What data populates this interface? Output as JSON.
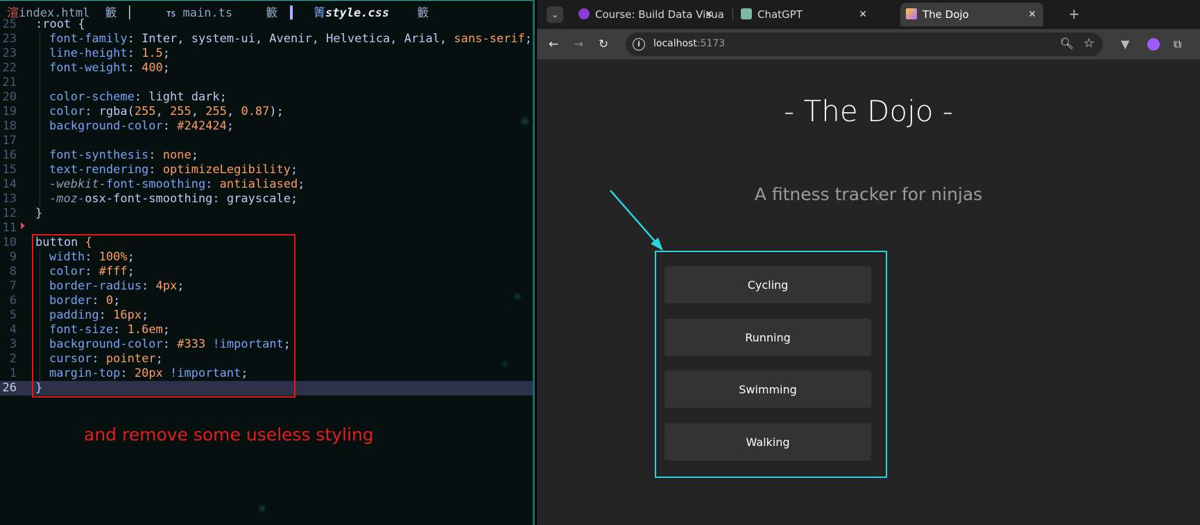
{
  "editor": {
    "tabs": [
      {
        "icon": "渲",
        "name": "index.html",
        "status": "籔"
      },
      {
        "icon": "TS",
        "name": "main.ts",
        "status": "籔"
      },
      {
        "icon": "箐",
        "name": "style.css",
        "status": "籔"
      }
    ],
    "lines": [
      {
        "num": "25",
        "parts": [
          [
            ":root {",
            "w"
          ]
        ]
      },
      {
        "num": "23",
        "in": true,
        "parts": [
          [
            "font-family",
            "p"
          ],
          [
            ": Inter, system-ui, Avenir, Helvetica, Arial, ",
            "w"
          ],
          [
            "sans-serif",
            "v"
          ],
          [
            ";",
            "w"
          ]
        ]
      },
      {
        "num": "23",
        "in": true,
        "parts": [
          [
            "line-height",
            "p"
          ],
          [
            ": ",
            "w"
          ],
          [
            "1.5",
            "v"
          ],
          [
            ";",
            "w"
          ]
        ]
      },
      {
        "num": "22",
        "in": true,
        "parts": [
          [
            "font-weight",
            "p"
          ],
          [
            ": ",
            "w"
          ],
          [
            "400",
            "v"
          ],
          [
            ";",
            "w"
          ]
        ]
      },
      {
        "num": "21",
        "in": true,
        "parts": []
      },
      {
        "num": "20",
        "in": true,
        "parts": [
          [
            "color-scheme",
            "p"
          ],
          [
            ": light dark;",
            "w"
          ]
        ]
      },
      {
        "num": "19",
        "in": true,
        "parts": [
          [
            "color",
            "p"
          ],
          [
            ": rgba(",
            "w"
          ],
          [
            "255",
            "v"
          ],
          [
            ", ",
            "w"
          ],
          [
            "255",
            "v"
          ],
          [
            ", ",
            "w"
          ],
          [
            "255",
            "v"
          ],
          [
            ", ",
            "w"
          ],
          [
            "0.87",
            "v"
          ],
          [
            ");",
            "w"
          ]
        ]
      },
      {
        "num": "18",
        "in": true,
        "parts": [
          [
            "background-color",
            "p"
          ],
          [
            ": ",
            "w"
          ],
          [
            "#242424",
            "v"
          ],
          [
            ";",
            "w"
          ]
        ]
      },
      {
        "num": "17",
        "in": true,
        "parts": []
      },
      {
        "num": "16",
        "in": true,
        "parts": [
          [
            "font-synthesis",
            "p"
          ],
          [
            ": ",
            "w"
          ],
          [
            "none",
            "v"
          ],
          [
            ";",
            "w"
          ]
        ]
      },
      {
        "num": "15",
        "in": true,
        "parts": [
          [
            "text-rendering",
            "p"
          ],
          [
            ": ",
            "w"
          ],
          [
            "optimizeLegibility",
            "v"
          ],
          [
            ";",
            "w"
          ]
        ]
      },
      {
        "num": "14",
        "in": true,
        "parts": [
          [
            "-webkit-",
            "it"
          ],
          [
            "font-smoothing",
            "p"
          ],
          [
            ": ",
            "w"
          ],
          [
            "antialiased",
            "v"
          ],
          [
            ";",
            "w"
          ]
        ]
      },
      {
        "num": "13",
        "in": true,
        "parts": [
          [
            "-moz-",
            "it"
          ],
          [
            "osx-font-smoothing",
            "w"
          ],
          [
            ": grayscale;",
            "w"
          ]
        ]
      },
      {
        "num": "12",
        "parts": [
          [
            "}",
            "w"
          ]
        ]
      },
      {
        "num": "11",
        "parts": []
      },
      {
        "num": "10",
        "parts": [
          [
            "button ",
            "w"
          ],
          [
            "{",
            "v"
          ]
        ]
      },
      {
        "num": "9",
        "in": true,
        "parts": [
          [
            "width",
            "p"
          ],
          [
            ": ",
            "w"
          ],
          [
            "100%",
            "v"
          ],
          [
            ";",
            "w"
          ]
        ]
      },
      {
        "num": "8",
        "in": true,
        "parts": [
          [
            "color",
            "p"
          ],
          [
            ": ",
            "w"
          ],
          [
            "#fff",
            "v"
          ],
          [
            ";",
            "w"
          ]
        ]
      },
      {
        "num": "7",
        "in": true,
        "parts": [
          [
            "border-radius",
            "p"
          ],
          [
            ": ",
            "w"
          ],
          [
            "4px",
            "v"
          ],
          [
            ";",
            "w"
          ]
        ]
      },
      {
        "num": "6",
        "in": true,
        "parts": [
          [
            "border",
            "p"
          ],
          [
            ": ",
            "w"
          ],
          [
            "0",
            "v"
          ],
          [
            ";",
            "w"
          ]
        ]
      },
      {
        "num": "5",
        "in": true,
        "parts": [
          [
            "padding",
            "p"
          ],
          [
            ": ",
            "w"
          ],
          [
            "16px",
            "v"
          ],
          [
            ";",
            "w"
          ]
        ]
      },
      {
        "num": "4",
        "in": true,
        "parts": [
          [
            "font-size",
            "p"
          ],
          [
            ": ",
            "w"
          ],
          [
            "1.6em",
            "v"
          ],
          [
            ";",
            "w"
          ]
        ]
      },
      {
        "num": "3",
        "in": true,
        "parts": [
          [
            "background-color",
            "p"
          ],
          [
            ": ",
            "w"
          ],
          [
            "#333",
            "v"
          ],
          [
            " !important",
            "p"
          ],
          [
            ";",
            "w"
          ]
        ]
      },
      {
        "num": "2",
        "in": true,
        "parts": [
          [
            "cursor",
            "p"
          ],
          [
            ": ",
            "w"
          ],
          [
            "pointer",
            "v"
          ],
          [
            ";",
            "w"
          ]
        ]
      },
      {
        "num": "1",
        "in": true,
        "parts": [
          [
            "margin-top",
            "p"
          ],
          [
            ": ",
            "w"
          ],
          [
            "20px",
            "v"
          ],
          [
            " !important",
            "p"
          ],
          [
            ";",
            "w"
          ]
        ]
      },
      {
        "num": "26",
        "cur": true,
        "parts": [
          [
            "}",
            "w"
          ]
        ]
      }
    ],
    "note": "and remove some useless styling"
  },
  "browser": {
    "tabs": [
      {
        "label": "Course: Build Data Visua",
        "icon_color": "#8b3ad6",
        "icon": "course-favicon-icon"
      },
      {
        "label": "ChatGPT",
        "icon_color": "#7fb8a8",
        "icon": "chatgpt-favicon-icon"
      },
      {
        "label": "The Dojo",
        "icon_color": "#b06cff",
        "icon": "vite-favicon-icon"
      }
    ],
    "new_tab": "+",
    "url_host": "localhost",
    "url_port": ":5173",
    "page": {
      "title": "- The Dojo -",
      "subtitle": "A fitness tracker for ninjas",
      "buttons": [
        "Cycling",
        "Running",
        "Swimming",
        "Walking"
      ]
    },
    "annotation_color": "#29d6e0"
  }
}
